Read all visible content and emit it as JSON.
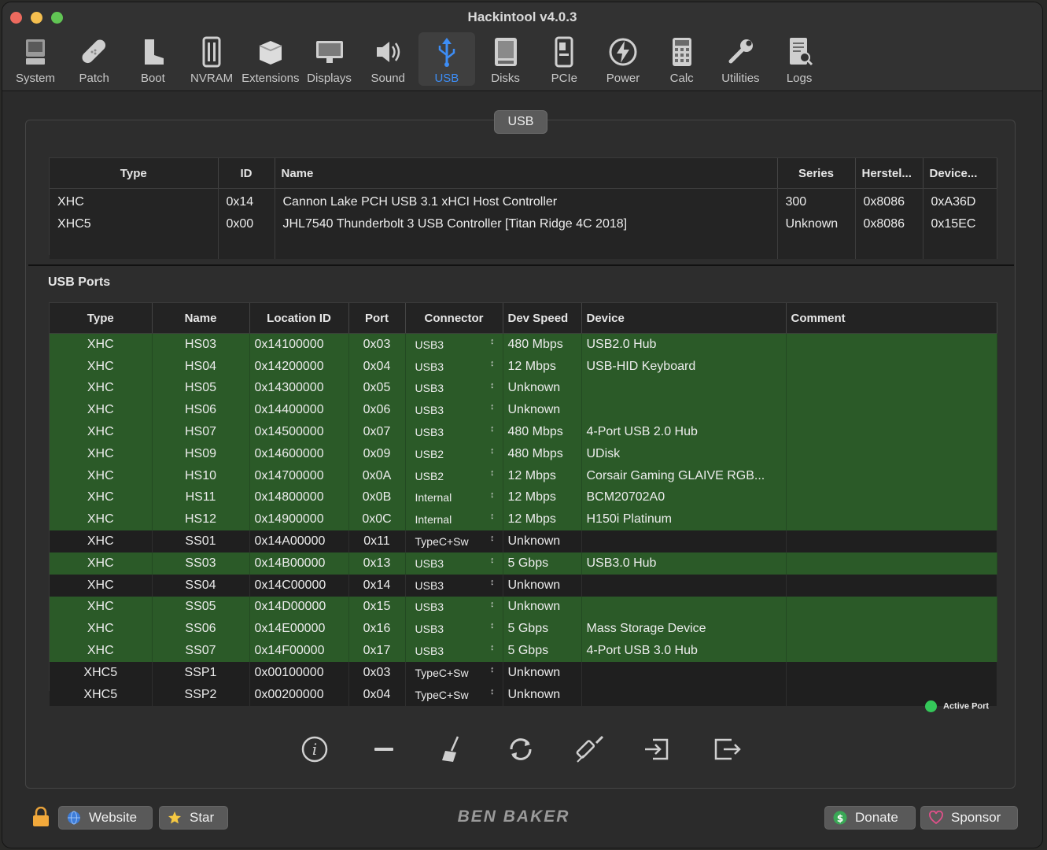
{
  "window": {
    "title": "Hackintool v4.0.3"
  },
  "toolbar": {
    "items": [
      {
        "label": "System",
        "icon": "computer-icon"
      },
      {
        "label": "Patch",
        "icon": "bandage-icon"
      },
      {
        "label": "Boot",
        "icon": "boot-icon"
      },
      {
        "label": "NVRAM",
        "icon": "memory-icon"
      },
      {
        "label": "Extensions",
        "icon": "extensions-icon"
      },
      {
        "label": "Displays",
        "icon": "display-icon"
      },
      {
        "label": "Sound",
        "icon": "speaker-icon"
      },
      {
        "label": "USB",
        "icon": "usb-icon",
        "selected": true
      },
      {
        "label": "Disks",
        "icon": "disk-icon"
      },
      {
        "label": "PCIe",
        "icon": "pcie-icon"
      },
      {
        "label": "Power",
        "icon": "power-icon"
      },
      {
        "label": "Calc",
        "icon": "calculator-icon"
      },
      {
        "label": "Utilities",
        "icon": "wrench-icon"
      },
      {
        "label": "Logs",
        "icon": "logs-icon"
      }
    ],
    "selected_color": "#3d8df5"
  },
  "panel": {
    "tab_label": "USB"
  },
  "controllers": {
    "headers": [
      "Type",
      "ID",
      "Name",
      "Series",
      "Herstel...",
      "Device..."
    ],
    "rows": [
      [
        "XHC",
        "0x14",
        "Cannon Lake PCH USB 3.1 xHCI Host Controller",
        "300",
        "0x8086",
        "0xA36D"
      ],
      [
        "XHC5",
        "0x00",
        "JHL7540 Thunderbolt 3 USB Controller [Titan Ridge 4C 2018]",
        "Unknown",
        "0x8086",
        "0x15EC"
      ]
    ]
  },
  "ports": {
    "section_title": "USB Ports",
    "headers": [
      "Type",
      "Name",
      "Location ID",
      "Port",
      "Connector",
      "Dev Speed",
      "Device",
      "Comment"
    ],
    "active_color": "#2b5a28",
    "rows": [
      {
        "type": "XHC",
        "name": "HS03",
        "location": "0x14100000",
        "port": "0x03",
        "connector": "USB3",
        "speed": "480 Mbps",
        "device": "USB2.0 Hub",
        "comment": "",
        "active": true
      },
      {
        "type": "XHC",
        "name": "HS04",
        "location": "0x14200000",
        "port": "0x04",
        "connector": "USB3",
        "speed": "12 Mbps",
        "device": "USB-HID Keyboard",
        "comment": "",
        "active": true
      },
      {
        "type": "XHC",
        "name": "HS05",
        "location": "0x14300000",
        "port": "0x05",
        "connector": "USB3",
        "speed": "Unknown",
        "device": "",
        "comment": "",
        "active": true
      },
      {
        "type": "XHC",
        "name": "HS06",
        "location": "0x14400000",
        "port": "0x06",
        "connector": "USB3",
        "speed": "Unknown",
        "device": "",
        "comment": "",
        "active": true
      },
      {
        "type": "XHC",
        "name": "HS07",
        "location": "0x14500000",
        "port": "0x07",
        "connector": "USB3",
        "speed": "480 Mbps",
        "device": "4-Port USB 2.0 Hub",
        "comment": "",
        "active": true
      },
      {
        "type": "XHC",
        "name": "HS09",
        "location": "0x14600000",
        "port": "0x09",
        "connector": "USB2",
        "speed": "480 Mbps",
        "device": "UDisk",
        "comment": "",
        "active": true
      },
      {
        "type": "XHC",
        "name": "HS10",
        "location": "0x14700000",
        "port": "0x0A",
        "connector": "USB2",
        "speed": "12 Mbps",
        "device": "Corsair Gaming GLAIVE RGB...",
        "comment": "",
        "active": true
      },
      {
        "type": "XHC",
        "name": "HS11",
        "location": "0x14800000",
        "port": "0x0B",
        "connector": "Internal",
        "speed": "12 Mbps",
        "device": "BCM20702A0",
        "comment": "",
        "active": true
      },
      {
        "type": "XHC",
        "name": "HS12",
        "location": "0x14900000",
        "port": "0x0C",
        "connector": "Internal",
        "speed": "12 Mbps",
        "device": "H150i Platinum",
        "comment": "",
        "active": true
      },
      {
        "type": "XHC",
        "name": "SS01",
        "location": "0x14A00000",
        "port": "0x11",
        "connector": "TypeC+Sw",
        "speed": "Unknown",
        "device": "",
        "comment": "",
        "active": false
      },
      {
        "type": "XHC",
        "name": "SS03",
        "location": "0x14B00000",
        "port": "0x13",
        "connector": "USB3",
        "speed": "5 Gbps",
        "device": "USB3.0 Hub",
        "comment": "",
        "active": true
      },
      {
        "type": "XHC",
        "name": "SS04",
        "location": "0x14C00000",
        "port": "0x14",
        "connector": "USB3",
        "speed": "Unknown",
        "device": "",
        "comment": "",
        "active": false
      },
      {
        "type": "XHC",
        "name": "SS05",
        "location": "0x14D00000",
        "port": "0x15",
        "connector": "USB3",
        "speed": "Unknown",
        "device": "",
        "comment": "",
        "active": true
      },
      {
        "type": "XHC",
        "name": "SS06",
        "location": "0x14E00000",
        "port": "0x16",
        "connector": "USB3",
        "speed": "5 Gbps",
        "device": "Mass Storage Device",
        "comment": "",
        "active": true
      },
      {
        "type": "XHC",
        "name": "SS07",
        "location": "0x14F00000",
        "port": "0x17",
        "connector": "USB3",
        "speed": "5 Gbps",
        "device": "4-Port USB 3.0 Hub",
        "comment": "",
        "active": true
      },
      {
        "type": "XHC5",
        "name": "SSP1",
        "location": "0x00100000",
        "port": "0x03",
        "connector": "TypeC+Sw",
        "speed": "Unknown",
        "device": "",
        "comment": "",
        "active": false
      },
      {
        "type": "XHC5",
        "name": "SSP2",
        "location": "0x00200000",
        "port": "0x04",
        "connector": "TypeC+Sw",
        "speed": "Unknown",
        "device": "",
        "comment": "",
        "active": false
      }
    ]
  },
  "legend": {
    "active_label": "Active Port",
    "active_color": "#34c759"
  },
  "actions": [
    {
      "icon": "info-icon"
    },
    {
      "icon": "minus-icon"
    },
    {
      "icon": "broom-icon"
    },
    {
      "icon": "refresh-icon"
    },
    {
      "icon": "syringe-icon"
    },
    {
      "icon": "import-icon"
    },
    {
      "icon": "export-icon"
    }
  ],
  "footer": {
    "website_label": "Website",
    "star_label": "Star",
    "brand_text": "BEN BAKER",
    "donate_label": "Donate",
    "sponsor_label": "Sponsor"
  }
}
